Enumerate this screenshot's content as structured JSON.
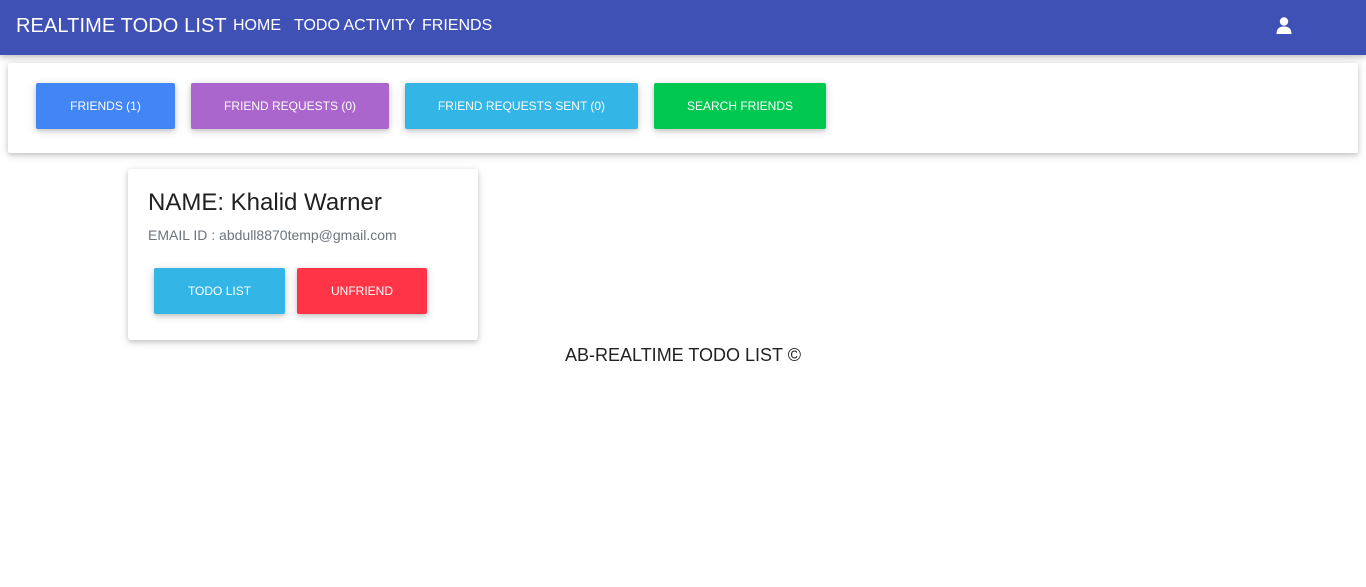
{
  "navbar": {
    "brand": "REALTIME TODO LIST",
    "links": [
      "HOME",
      "TODO ACTIVITY",
      "FRIENDS"
    ],
    "user_icon": "user-icon",
    "bg_color": "#3f51b5"
  },
  "toolbar": {
    "friends": "FRIENDS (1)",
    "friend_requests": "FRIEND REQUESTS (0)",
    "friend_requests_sent": "FRIEND REQUESTS SENT (0)",
    "search_friends": "SEARCH FRIENDS",
    "colors": {
      "friends": "#4285f4",
      "friend_requests": "#aa66cc",
      "friend_requests_sent": "#33b5e5",
      "search_friends": "#00c851"
    }
  },
  "friend": {
    "name": "NAME: Khalid Warner",
    "email": "EMAIL ID : abdull8870temp@gmail.com",
    "todo_list_label": "TODO LIST",
    "unfriend_label": "UNFRIEND",
    "colors": {
      "todo_list": "#33b5e5",
      "unfriend": "#ff3547"
    }
  },
  "footer": {
    "text": "AB-REALTIME TODO LIST ©"
  }
}
